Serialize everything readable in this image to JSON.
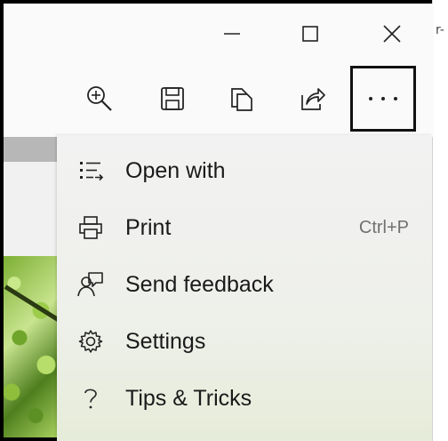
{
  "window": {
    "title_peek": "r-",
    "controls": {
      "minimize": "minimize-icon",
      "maximize": "maximize-icon",
      "close": "close-icon"
    }
  },
  "toolbar": {
    "buttons": [
      {
        "icon": "zoom-in-icon"
      },
      {
        "icon": "save-icon"
      },
      {
        "icon": "copy-icon"
      },
      {
        "icon": "share-icon"
      }
    ],
    "more_icon": "more-options-icon"
  },
  "menu": {
    "items": [
      {
        "label": "Open with",
        "icon": "open-with-icon",
        "shortcut": ""
      },
      {
        "label": "Print",
        "icon": "printer-icon",
        "shortcut": "Ctrl+P"
      },
      {
        "label": "Send feedback",
        "icon": "feedback-icon",
        "shortcut": ""
      },
      {
        "label": "Settings",
        "icon": "gear-icon",
        "shortcut": ""
      },
      {
        "label": "Tips & Tricks",
        "icon": "question-icon",
        "shortcut": ""
      }
    ]
  },
  "colors": {
    "frame": "#000000",
    "menu_bg": "#f2f2f2",
    "text": "#1a1a1a",
    "shortcut": "#707070"
  }
}
